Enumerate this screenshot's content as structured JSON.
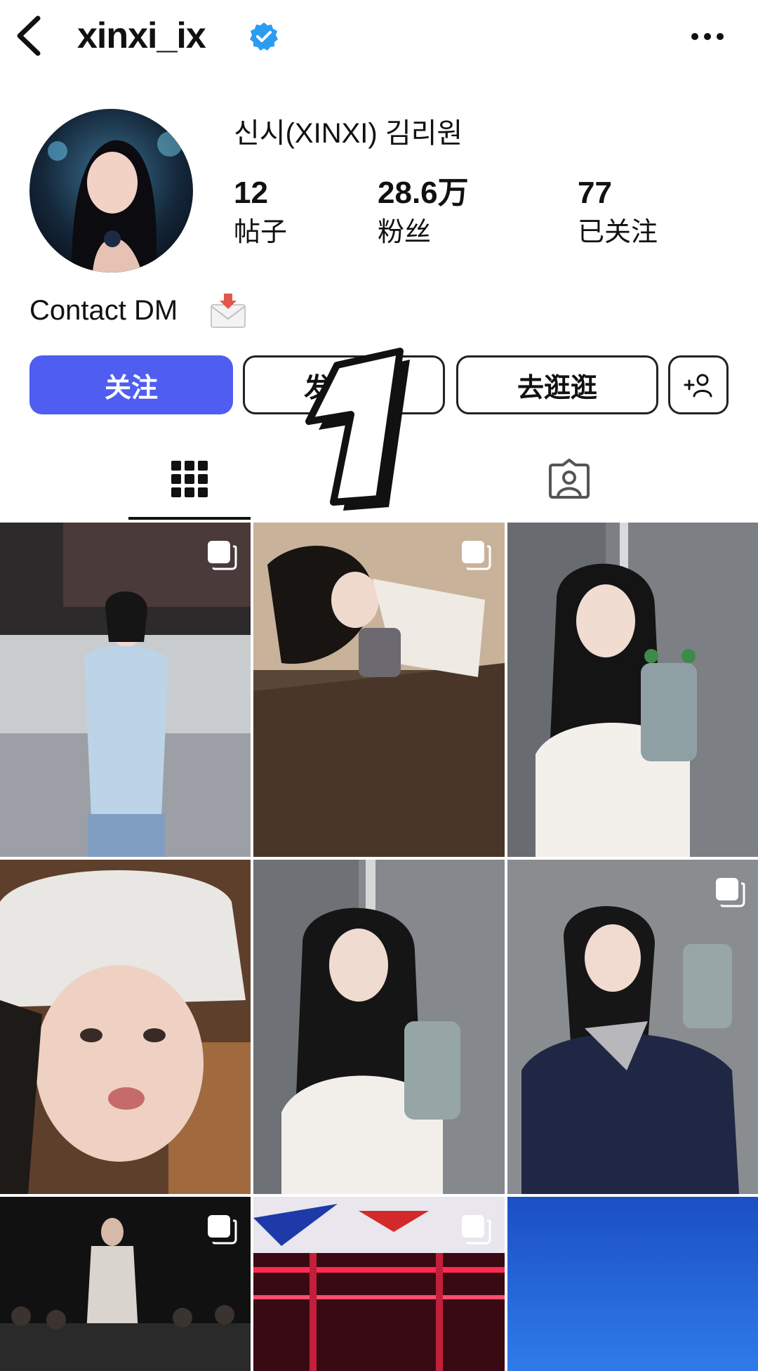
{
  "header": {
    "username": "xinxi_ix",
    "back_icon": "chevron-left-icon",
    "verified_icon": "verified-badge-icon",
    "more_icon": "more-horizontal-icon"
  },
  "profile": {
    "display_name": "신시(XINXI) 김리원",
    "stats": [
      {
        "value": "12",
        "label": "帖子"
      },
      {
        "value": "28.6万",
        "label": "粉丝"
      },
      {
        "value": "77",
        "label": "已关注"
      }
    ],
    "bio": "Contact DM"
  },
  "buttons": {
    "follow": "关注",
    "message": "发消息",
    "explore": "去逛逛",
    "add_user_icon": "add-user-icon"
  },
  "tabs": {
    "grid_icon": "grid-icon",
    "tagged_icon": "tagged-person-icon"
  },
  "overlay": {
    "sticker_text": "1"
  },
  "colors": {
    "accent": "#4f5df0",
    "verified": "#2b9cf2",
    "text": "#111111"
  },
  "posts": [
    {
      "description": "woman in light blue cardigan against white wall",
      "multi": true
    },
    {
      "description": "woman lying down with phone",
      "multi": true
    },
    {
      "description": "mirror selfie white blouse",
      "multi": false
    },
    {
      "description": "woman in white knit bucket hat",
      "multi": false
    },
    {
      "description": "mirror selfie white cardigan",
      "multi": false
    },
    {
      "description": "selfie with navy cardigan and scarf",
      "multi": true
    },
    {
      "description": "fashion runway show",
      "multi": true
    },
    {
      "description": "red neon stage",
      "multi": true
    },
    {
      "description": "blue sky",
      "multi": false
    }
  ]
}
